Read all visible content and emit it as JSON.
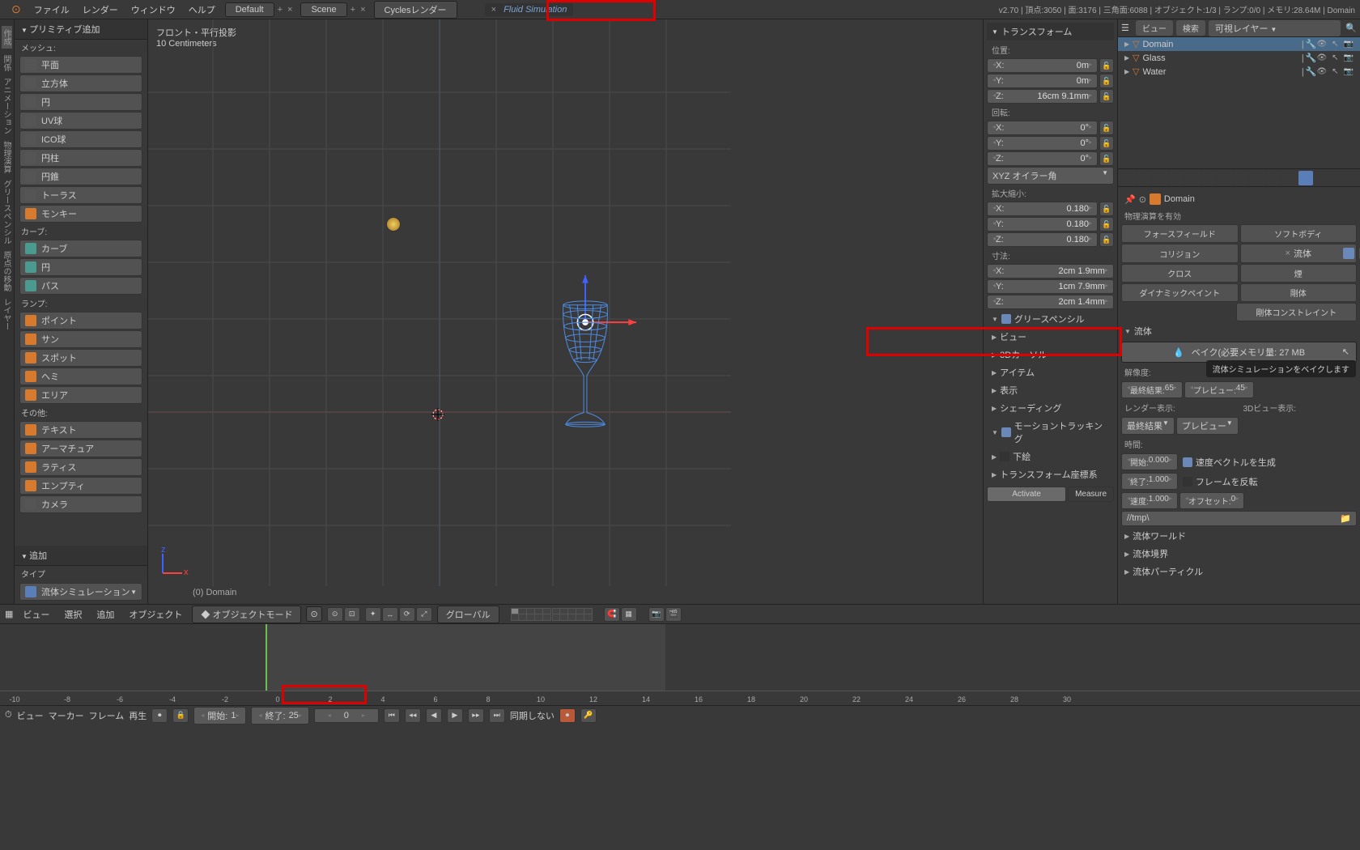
{
  "topbar": {
    "menus": [
      "ファイル",
      "レンダー",
      "ウィンドウ",
      "ヘルプ"
    ],
    "layout": "Default",
    "scene": "Scene",
    "renderer": "Cyclesレンダー",
    "job": "Fluid Simulation",
    "stats": "v2.70 | 頂点:3050 | 面:3176 | 三角面:6088 | オブジェクト:1/3 | ランプ:0/0 | メモリ:28.64M | Domain"
  },
  "tool_panel": {
    "header": "プリミティブ追加",
    "mesh_cat": "メッシュ:",
    "mesh": [
      "平面",
      "立方体",
      "円",
      "UV球",
      "ICO球",
      "円柱",
      "円錐",
      "トーラス",
      "モンキー"
    ],
    "curve_cat": "カーブ:",
    "curve": [
      "カーブ",
      "円",
      "パス"
    ],
    "lamp_cat": "ランプ:",
    "lamp": [
      "ポイント",
      "サン",
      "スポット",
      "ヘミ",
      "エリア"
    ],
    "other_cat": "その他:",
    "other": [
      "テキスト",
      "アーマチュア",
      "ラティス",
      "エンプティ",
      "カメラ"
    ],
    "add_header": "追加",
    "type_label": "タイプ",
    "type_value": "流体シミュレーション"
  },
  "viewport": {
    "view_name": "フロント・平行投影",
    "scale": "10 Centimeters",
    "obj_label": "(0) Domain"
  },
  "npanel": {
    "transform": "トランスフォーム",
    "loc": "位置:",
    "loc_x": {
      "l": "X:",
      "v": "0m"
    },
    "loc_y": {
      "l": "Y:",
      "v": "0m"
    },
    "loc_z": {
      "l": "Z:",
      "v": "16cm 9.1mm"
    },
    "rot": "回転:",
    "rot_x": {
      "l": "X:",
      "v": "0°"
    },
    "rot_y": {
      "l": "Y:",
      "v": "0°"
    },
    "rot_z": {
      "l": "Z:",
      "v": "0°"
    },
    "rot_mode": "XYZ オイラー角",
    "scale": "拡大縮小:",
    "scale_x": {
      "l": "X:",
      "v": "0.180"
    },
    "scale_y": {
      "l": "Y:",
      "v": "0.180"
    },
    "scale_z": {
      "l": "Z:",
      "v": "0.180"
    },
    "dim": "寸法:",
    "dim_x": {
      "l": "X:",
      "v": "2cm 1.9mm"
    },
    "dim_y": {
      "l": "Y:",
      "v": "1cm 7.9mm"
    },
    "dim_z": {
      "l": "Z:",
      "v": "2cm 1.4mm"
    },
    "sections": [
      "グリースペンシル",
      "ビュー",
      "3Dカーソル",
      "アイテム",
      "表示",
      "シェーディング",
      "モーショントラッキング",
      "下絵",
      "トランスフォーム座標系"
    ],
    "activate": "Activate",
    "measure": "Measure"
  },
  "outliner": {
    "view_btn": "ビュー",
    "search": "検索",
    "layer": "可視レイヤー",
    "items": [
      {
        "name": "Domain"
      },
      {
        "name": "Glass"
      },
      {
        "name": "Water"
      }
    ]
  },
  "props": {
    "crumb": "Domain",
    "enable_header": "物理演算を有効",
    "btns_l": [
      "フォースフィールド",
      "コリジョン",
      "クロス",
      "ダイナミックペイント"
    ],
    "btns_r": [
      "ソフトボディ",
      "流体",
      "煙",
      "剛体",
      "剛体コンストレイント"
    ],
    "fluid_header": "流体",
    "bake_btn": "ベイク(必要メモリ量: 27 MB",
    "bake_tooltip": "流体シミュレーションをベイクします",
    "resolution": "解像度:",
    "final": {
      "l": "最終結果:",
      "v": "65"
    },
    "preview": {
      "l": "プレビュー:",
      "v": "45"
    },
    "render_disp": "レンダー表示:",
    "view3d_disp": "3Dビュー表示:",
    "final_dd": "最終結果",
    "preview_dd": "プレビュー",
    "time": "時間:",
    "start": {
      "l": "開始:",
      "v": "0.000"
    },
    "end": {
      "l": "終了:",
      "v": "1.000"
    },
    "speed": {
      "l": "速度:",
      "v": "1.000"
    },
    "gen_vel": "速度ベクトルを生成",
    "rev_frames": "フレームを反転",
    "offset": {
      "l": "オフセット:",
      "v": "0"
    },
    "path": "//tmp\\",
    "collapsed": [
      "流体ワールド",
      "流体境界",
      "流体パーティクル"
    ]
  },
  "view_footer": {
    "items": [
      "ビュー",
      "選択",
      "追加",
      "オブジェクト"
    ],
    "mode": "オブジェクトモード",
    "orient": "グローバル"
  },
  "timeline": {
    "ticks": [
      "-10",
      "-8",
      "-6",
      "-4",
      "-2",
      "0",
      "2",
      "4",
      "6",
      "8",
      "10",
      "12",
      "14",
      "16",
      "18",
      "20",
      "22",
      "24",
      "26",
      "28",
      "30"
    ],
    "footer_items": [
      "ビュー",
      "マーカー",
      "フレーム",
      "再生"
    ],
    "start": {
      "l": "開始:",
      "v": "1"
    },
    "end": {
      "l": "終了:",
      "v": "25"
    },
    "current": "0",
    "sync": "同期しない"
  }
}
